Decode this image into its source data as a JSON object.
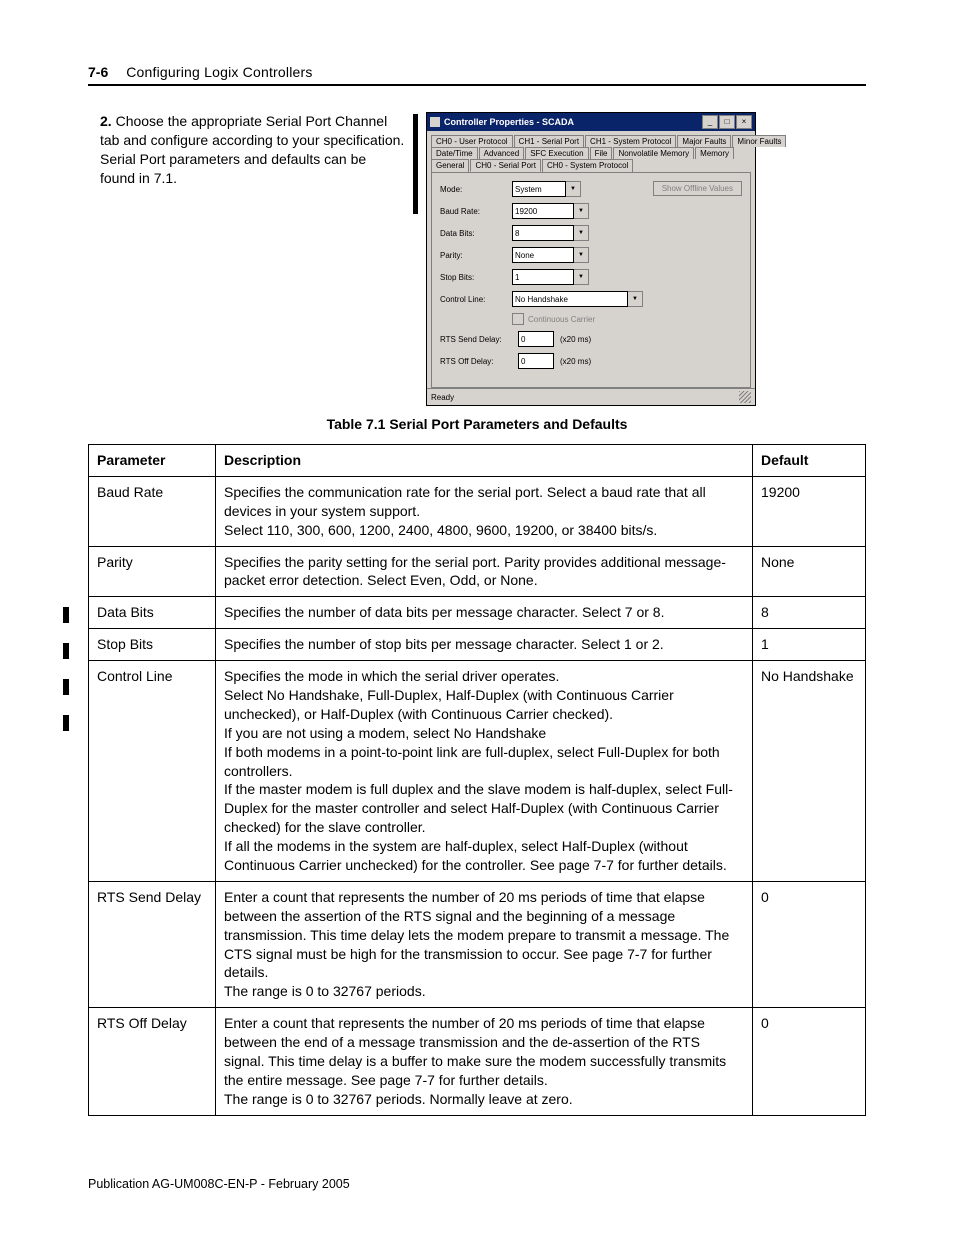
{
  "header": {
    "page_num": "7-6",
    "chapter": "Configuring Logix Controllers"
  },
  "step": {
    "num": "2.",
    "text": "Choose the appropriate Serial Port Channel tab and configure according to your specification. Serial Port parameters and defaults can be found in 7.1."
  },
  "dialog": {
    "title": "Controller Properties - SCADA",
    "tabs_row1": [
      "CH0 - User Protocol",
      "CH1 - Serial Port",
      "CH1 - System Protocol",
      "Major Faults",
      "Minor Faults"
    ],
    "tabs_row2": [
      "Date/Time",
      "Advanced",
      "SFC Execution",
      "File",
      "Nonvolatile Memory",
      "Memory"
    ],
    "tabs_row3": [
      "General",
      "CH0 - Serial Port",
      "CH0 - System Protocol"
    ],
    "fields": {
      "mode": {
        "label": "Mode:",
        "value": "System"
      },
      "baud": {
        "label": "Baud Rate:",
        "value": "19200"
      },
      "data_bits": {
        "label": "Data Bits:",
        "value": "8"
      },
      "parity": {
        "label": "Parity:",
        "value": "None"
      },
      "stop_bits": {
        "label": "Stop Bits:",
        "value": "1"
      },
      "control_line": {
        "label": "Control Line:",
        "value": "No Handshake"
      },
      "cc_label": "Continuous Carrier",
      "rts_send": {
        "label": "RTS Send Delay:",
        "value": "0",
        "unit": "(x20 ms)"
      },
      "rts_off": {
        "label": "RTS Off Delay:",
        "value": "0",
        "unit": "(x20 ms)"
      }
    },
    "button": "Show Offline Values",
    "status": "Ready"
  },
  "table": {
    "caption": "Table 7.1 Serial Port Parameters and Defaults",
    "headers": [
      "Parameter",
      "Description",
      "Default"
    ],
    "rows": [
      {
        "p": "Baud Rate",
        "d": "Specifies the communication rate for the serial port. Select a baud rate that all devices in your system support.\nSelect 110, 300, 600, 1200, 2400, 4800, 9600, 19200, or 38400 bits/s.",
        "def": "19200"
      },
      {
        "p": "Parity",
        "d": "Specifies the parity setting for the serial port. Parity provides additional message-packet error detection. Select Even, Odd, or None.",
        "def": "None"
      },
      {
        "p": "Data Bits",
        "d": "Specifies the number of data bits per message character. Select 7 or 8.",
        "def": "8"
      },
      {
        "p": "Stop Bits",
        "d": "Specifies the number of stop bits per message character. Select 1 or 2.",
        "def": "1"
      },
      {
        "p": "Control Line",
        "d": "Specifies the mode in which the serial driver operates.\nSelect No Handshake, Full-Duplex, Half-Duplex (with Continuous Carrier unchecked), or Half-Duplex (with Continuous Carrier checked).\nIf you are not using a modem, select No Handshake\nIf both modems in a point-to-point link are full-duplex, select Full-Duplex for both controllers.\nIf the master modem is full duplex and the slave modem is half-duplex, select Full-Duplex for the master controller and select Half-Duplex (with Continuous Carrier checked) for the slave controller.\nIf all the modems in the system are half-duplex, select Half-Duplex (without Continuous Carrier unchecked) for the controller. See page 7-7 for further details.",
        "def": "No Handshake"
      },
      {
        "p": "RTS Send Delay",
        "d": "Enter a count that represents the number of 20 ms periods of time that elapse between the assertion of the RTS signal and the beginning of a message transmission. This time delay lets the modem prepare to transmit a message. The CTS signal must be high for the transmission to occur. See page 7-7 for further details.\nThe range is 0 to 32767 periods.",
        "def": "0"
      },
      {
        "p": "RTS Off Delay",
        "d": "Enter a count that represents the number of 20 ms periods of time that elapse between the end of a message transmission and the de-assertion of the RTS signal. This time delay is a buffer to make sure the modem successfully transmits the entire message. See page 7-7 for further details.\nThe range is 0 to 32767 periods. Normally leave at zero.",
        "def": "0"
      }
    ]
  },
  "footer": "Publication AG-UM008C-EN-P - February 2005"
}
